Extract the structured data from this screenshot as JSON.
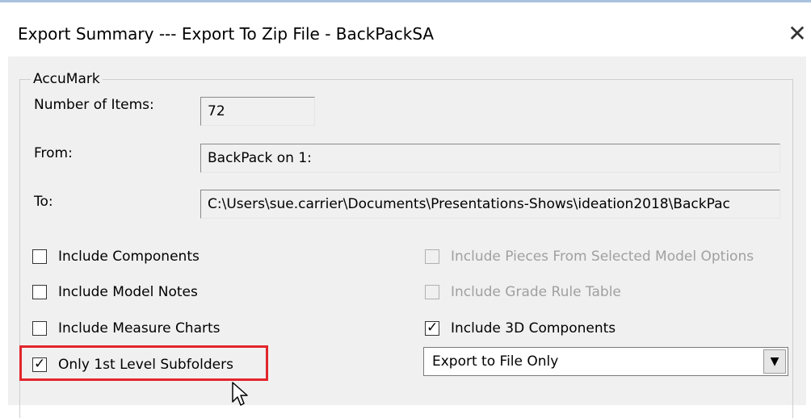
{
  "window": {
    "title": "Export Summary --- Export To Zip File - BackPackSA",
    "close_glyph": "✕"
  },
  "group": {
    "label": "AccuMark"
  },
  "fields": {
    "items_label": "Number of Items:",
    "items_value": "72",
    "from_label": "From:",
    "from_value": "BackPack on 1:",
    "to_label": "To:",
    "to_value": "C:\\Users\\sue.carrier\\Documents\\Presentations-Shows\\ideation2018\\BackPac"
  },
  "options_left": [
    {
      "label": "Include Components",
      "checked": false,
      "enabled": true
    },
    {
      "label": "Include Model Notes",
      "checked": false,
      "enabled": true
    },
    {
      "label": "Include Measure Charts",
      "checked": false,
      "enabled": true
    },
    {
      "label": "Only 1st Level Subfolders",
      "checked": true,
      "enabled": true
    }
  ],
  "options_right": [
    {
      "label": "Include Pieces From Selected Model Options",
      "checked": false,
      "enabled": false
    },
    {
      "label": "Include Grade Rule Table",
      "checked": false,
      "enabled": false
    },
    {
      "label": "Include 3D Components",
      "checked": true,
      "enabled": true
    }
  ],
  "export_mode": {
    "selected": "Export to File Only",
    "arrow_glyph": "▼"
  },
  "colors": {
    "highlight": "#e2252b",
    "panel": "#f0f0f0"
  }
}
